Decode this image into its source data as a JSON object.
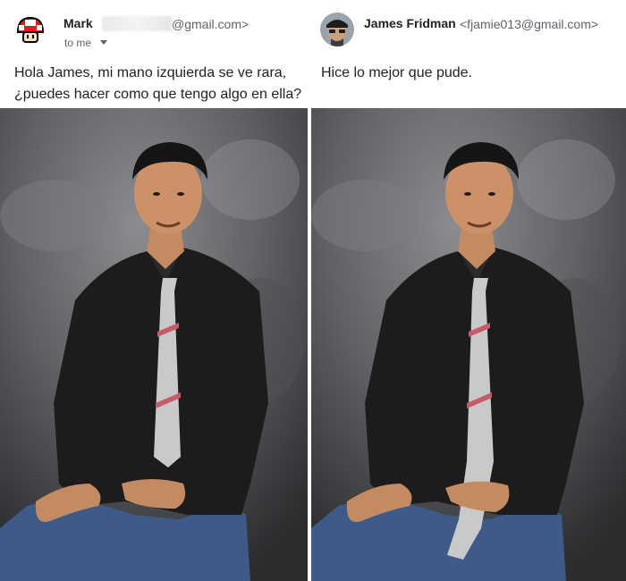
{
  "left_email": {
    "sender_name": "Mark",
    "sender_email_suffix": "@gmail.com>",
    "recipient_line": "to me",
    "avatar_icon": "mushroom-icon",
    "body_line1": "Hola James, mi mano izquierda se ve rara,",
    "body_line2": "¿puedes hacer como que tengo algo en ella?"
  },
  "right_email": {
    "sender_name": "James Fridman",
    "sender_email": "<fjamie013@gmail.com>",
    "avatar_icon": "profile-photo-avatar",
    "body": "Hice lo mejor que pude."
  },
  "colors": {
    "background": "#ffffff",
    "name_text": "#202124",
    "email_text": "#5f6368",
    "body_text": "#222222",
    "mushroom_red": "#e21b1b",
    "shirt": "#1c1c1c",
    "jeans": "#3e5a86",
    "backdrop": "#5a5c5e"
  }
}
